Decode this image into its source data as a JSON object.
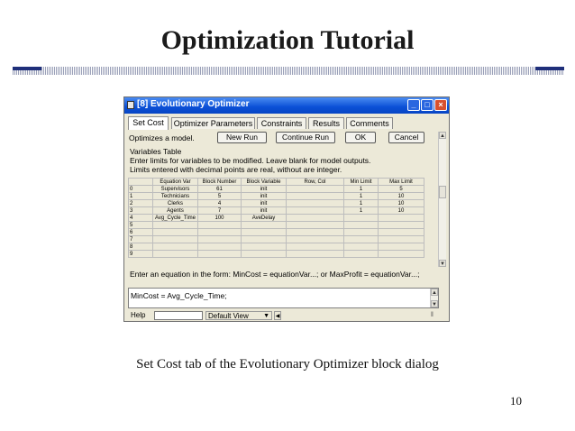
{
  "slide": {
    "title": "Optimization Tutorial",
    "caption": "Set Cost tab of the Evolutionary Optimizer block dialog",
    "page_number": "10"
  },
  "window": {
    "title": "[8]  Evolutionary Optimizer",
    "controls": {
      "minimize": "_",
      "maximize": "□",
      "close": "×"
    }
  },
  "tabs": [
    "Set Cost",
    "Optimizer Parameters",
    "Constraints",
    "Results",
    "Comments"
  ],
  "active_tab": "Set Cost",
  "intro": "Optimizes a model.",
  "buttons": {
    "new_run": "New Run",
    "continue_run": "Continue Run",
    "ok": "OK",
    "cancel": "Cancel"
  },
  "variables_table": {
    "label": "Variables Table",
    "instruction1": "Enter limits for variables to be modified. Leave blank for model outputs.",
    "instruction2": "Limits entered with decimal points are real, without are integer.",
    "headers": [
      "",
      "Equation Var",
      "Block Number",
      "Block Variable",
      "Row, Col",
      "Min Limit",
      "Max Limit"
    ],
    "rows": [
      [
        "0",
        "Supervisors",
        "61",
        "init",
        "",
        "1",
        "5"
      ],
      [
        "1",
        "Technicians",
        "5",
        "init",
        "",
        "1",
        "10"
      ],
      [
        "2",
        "Clerks",
        "4",
        "init",
        "",
        "1",
        "10"
      ],
      [
        "3",
        "Agents",
        "7",
        "init",
        "",
        "1",
        "10"
      ],
      [
        "4",
        "Avg_Cycle_Time",
        "100",
        "AveDelay",
        "",
        "",
        ""
      ],
      [
        "5",
        "",
        "",
        "",
        "",
        "",
        ""
      ],
      [
        "6",
        "",
        "",
        "",
        "",
        "",
        ""
      ],
      [
        "7",
        "",
        "",
        "",
        "",
        "",
        ""
      ],
      [
        "8",
        "",
        "",
        "",
        "",
        "",
        ""
      ],
      [
        "9",
        "",
        "",
        "",
        "",
        "",
        ""
      ]
    ]
  },
  "equation": {
    "prompt": "Enter an equation in the form: MinCost = equationVar...; or MaxProfit = equationVar...;",
    "value": "MinCost = Avg_Cycle_Time;"
  },
  "statusbar": {
    "help": "Help",
    "view": "Default View"
  },
  "colors": {
    "titlebar": "#0a4fd6",
    "rule_block": "#1f2f7a",
    "dialog_bg": "#ece9d8"
  }
}
